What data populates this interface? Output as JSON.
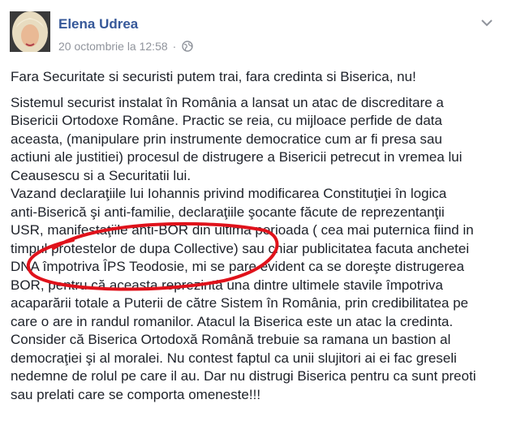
{
  "post": {
    "author": "Elena Udrea",
    "timestamp": "20 octombrie la 12:58",
    "separator": "·",
    "privacy_icon": "globe-icon",
    "options_icon": "chevron-down-icon",
    "headline": "Fara Securitate si securisti putem trai, fara credinta si Biserica, nu!",
    "lines": [
      "Sistemul securist instalat în România a lansat un atac de discreditare a",
      "Bisericii Ortodoxe Române. Practic se reia, cu mijloace perfide de data",
      "aceasta, (manipulare prin instrumente democratice cum ar fi presa sau",
      "actiuni ale justitiei) procesul de distrugere a Bisericii petrecut in vremea lui",
      "Ceausescu si a Securitatii lui.",
      "Vazand declaraţiile lui Iohannis privind modificarea Constituţiei în logica",
      "anti-Biserică şi anti-familie, declaraţiile şocante făcute de reprezentanţii",
      "USR, manifestaţiile anti-BOR din ultima perioada ( cea mai puternica fiind in",
      "timpul protestelor de dupa Collective) sau chiar publicitatea facuta anchetei",
      "DNA împotriva ÎPS Teodosie, mi se pare evident ca se doreşte distrugerea",
      "BOR, pentru că aceasta reprezintă una dintre ultimele stavile împotriva",
      "acaparării totale a Puterii de către Sistem în România, prin credibilitatea pe",
      "care o are in randul romanilor. Atacul la Biserica este un atac la credinta.",
      "Consider că Biserica Ortodoxă Română trebuie sa ramana un bastion al",
      "democraţiei şi al moralei. Nu contest faptul ca unii slujitori ai ei fac greseli",
      "nedemne de rolul pe care il au. Dar nu distrugi Biserica pentru ca sunt preoti",
      "sau prelati care se comporta omeneste!!!"
    ]
  },
  "colors": {
    "author": "#365899",
    "meta": "#90949c",
    "text": "#1d2129",
    "annotation": "#e0121b"
  }
}
